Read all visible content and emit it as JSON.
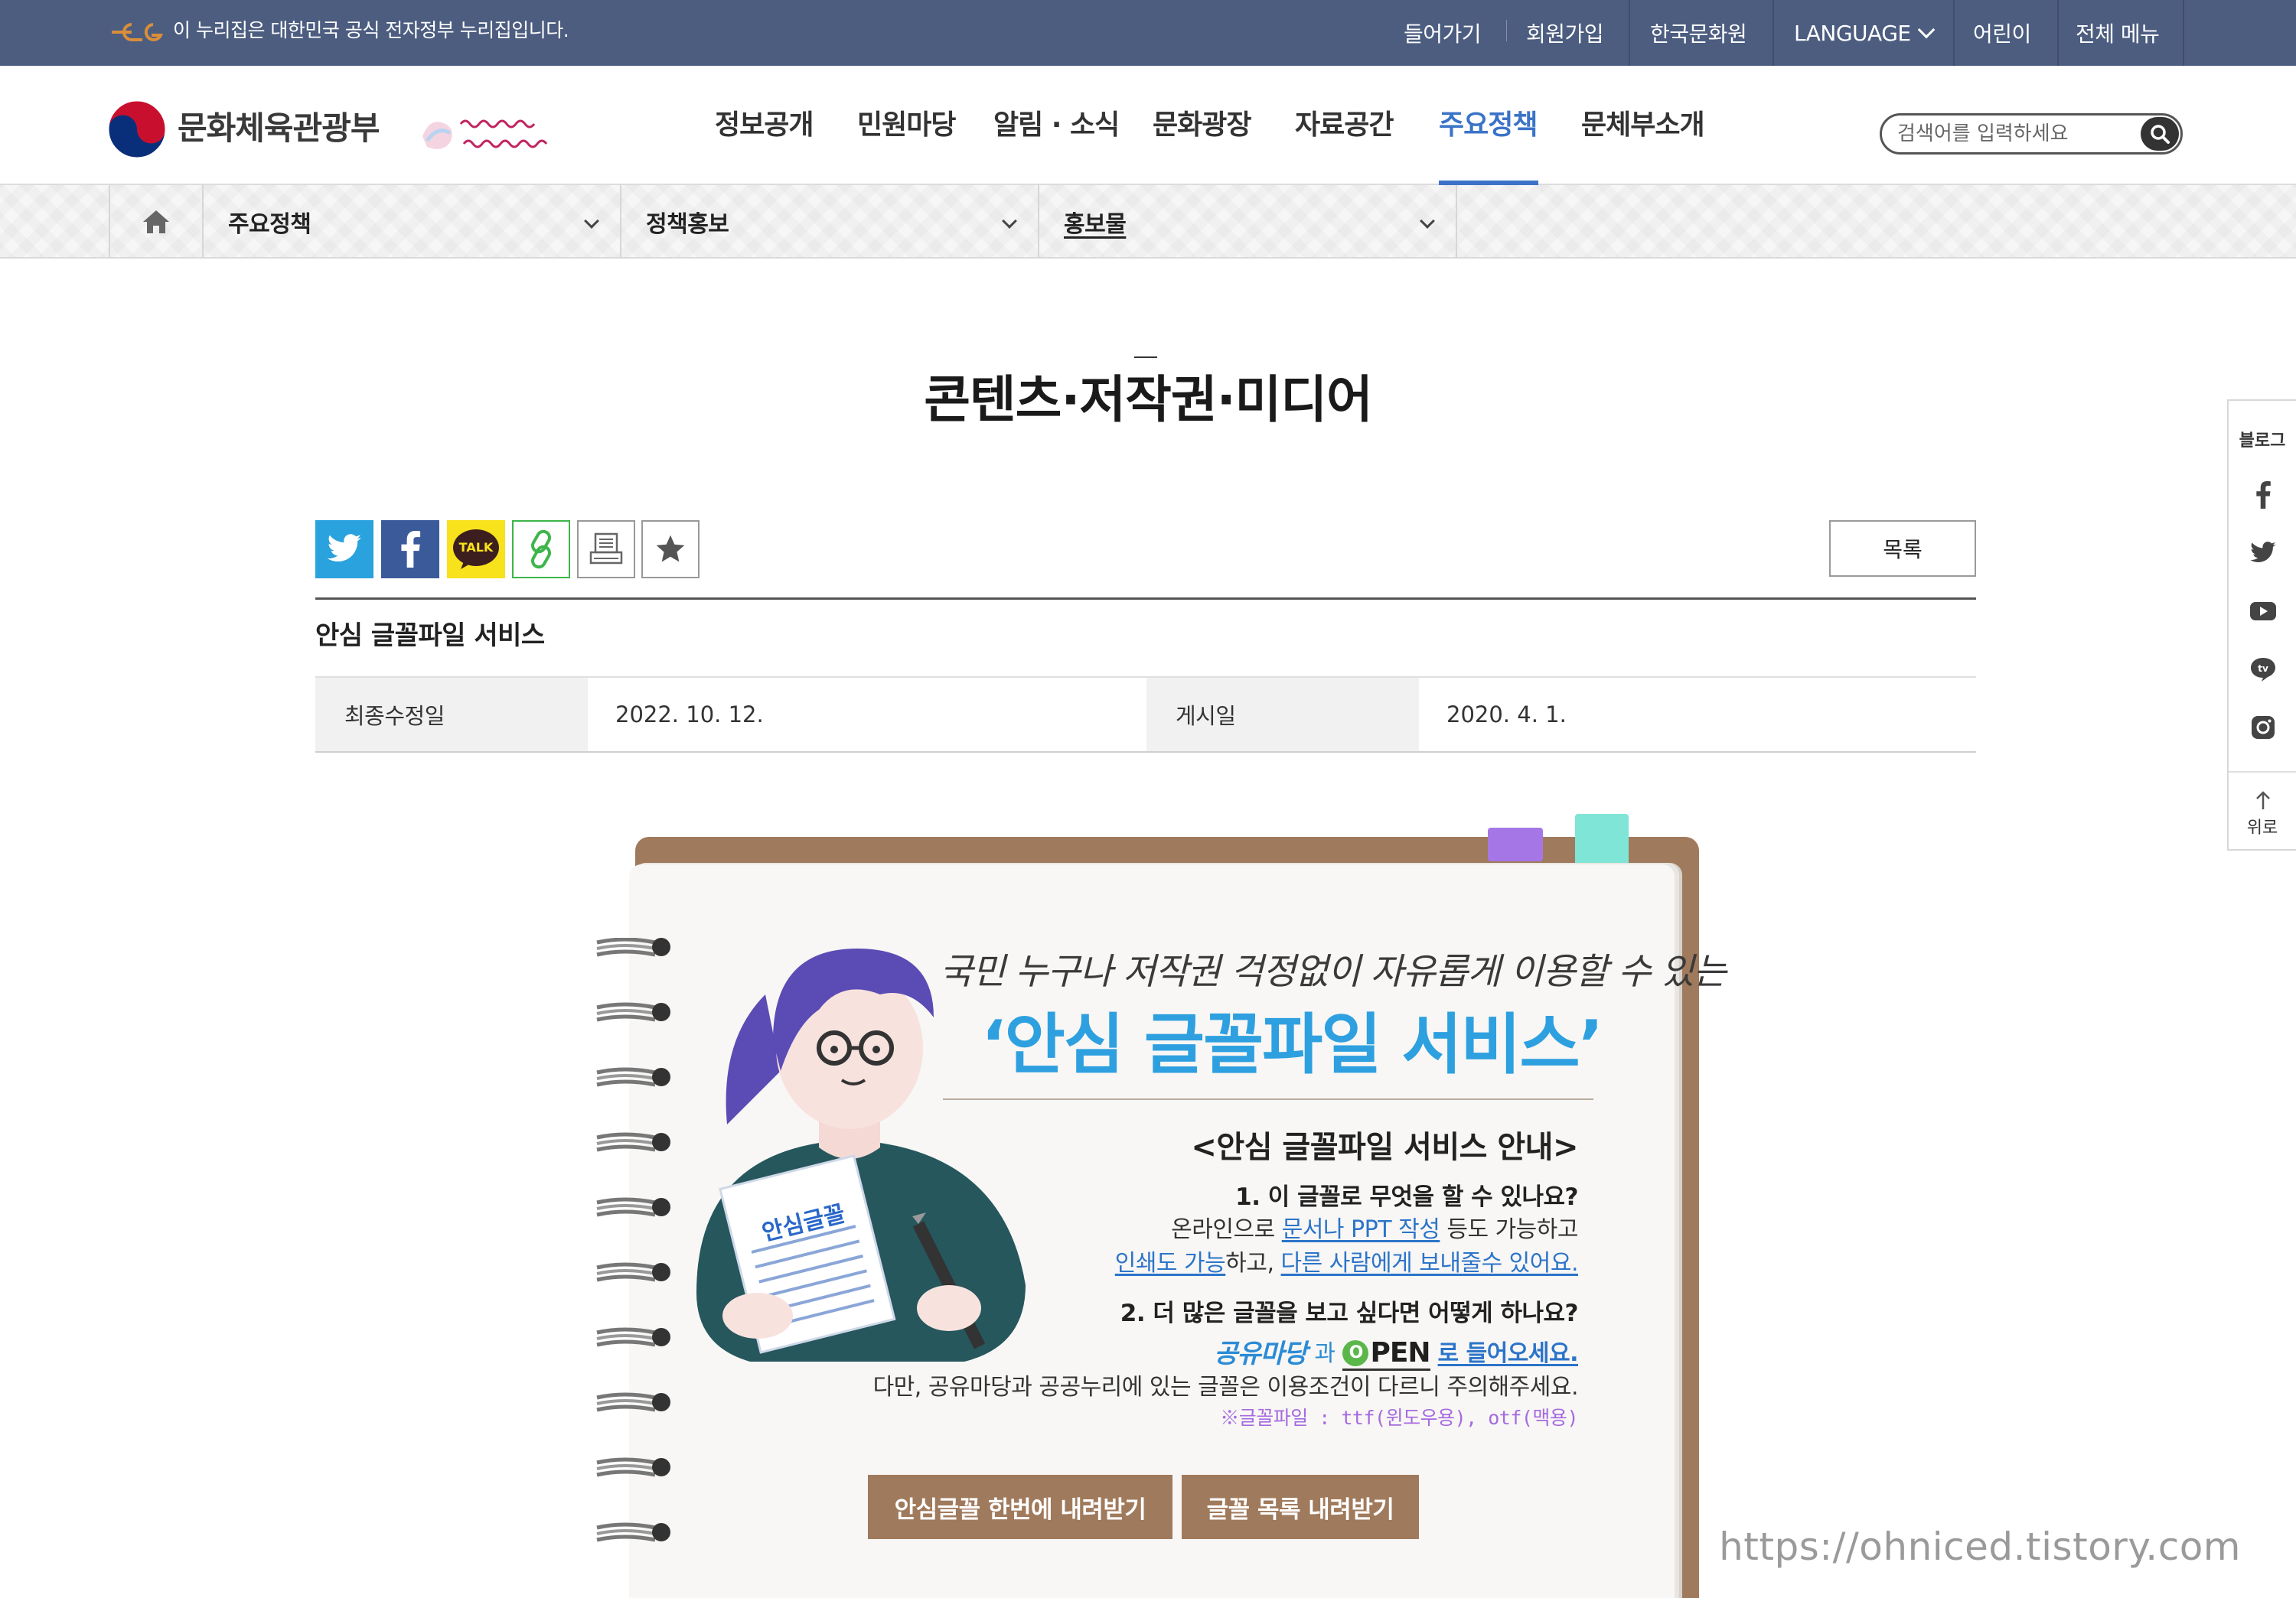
{
  "topbar": {
    "gov_notice": "이 누리집은 대한민국 공식 전자정부 누리집입니다.",
    "login": "들어가기",
    "signup": "회원가입",
    "culture_center": "한국문화원",
    "language": "LANGUAGE",
    "kids": "어린이",
    "all_menu": "전체 메뉴"
  },
  "header": {
    "ministry": "문화체육관광부",
    "nav": [
      "정보공개",
      "민원마당",
      "알림 · 소식",
      "문화광장",
      "자료공간",
      "주요정책",
      "문체부소개"
    ],
    "active_nav": "주요정책",
    "search_placeholder": "검색어를 입력하세요"
  },
  "location": {
    "level1": "주요정책",
    "level2": "정책홍보",
    "level3": "홍보물"
  },
  "page": {
    "title": "콘텐츠·저작권·미디어",
    "list_button": "목록",
    "post_title": "안심 글꼴파일 서비스",
    "modified_label": "최종수정일",
    "modified_value": "2022. 10. 12.",
    "posted_label": "게시일",
    "posted_value": "2020. 4. 1."
  },
  "share": {
    "kakao_label": "TALK"
  },
  "illustration": {
    "handwritten": "국민 누구나 저작권 걱정없이 자유롭게 이용할 수 있는",
    "hero_title": "‘안심 글꼴파일 서비스’",
    "paper_label": "안심글꼴",
    "guide_heading": "<안심 글꼴파일 서비스 안내>",
    "q1": "1. 이 글꼴로 무엇을 할 수 있나요?",
    "a1_pre": "온라인으로 ",
    "a1_link": "문서나 PPT 작성",
    "a1_post": " 등도 가능하고",
    "a2_link1": "인쇄도 가능",
    "a2_mid": "하고, ",
    "a2_link2": "다른 사람에게 보내줄수 있어요.",
    "q2": "2. 더 많은  글꼴을 보고 싶다면 어떻게 하나요?",
    "gongyu": "공유마당",
    "gwa": "과",
    "open": "PEN",
    "open_suffix": "로 들어오세요.",
    "caution": "다만, 공유마당과 공공누리에 있는 글꼴은 이용조건이 다르니 주의해주세요.",
    "filetype": "※글꼴파일 : ttf(윈도우용), otf(맥용)",
    "download_all": "안심글꼴 한번에 내려받기",
    "download_list": "글꼴 목록 내려받기"
  },
  "watermark": "https://ohniced.tistory.com",
  "quickbar": {
    "blog": "블로그",
    "top": "위로"
  },
  "colors": {
    "topbar": "#4c5d80",
    "accent": "#3b73c8",
    "hero_blue": "#2ea0e0",
    "brown": "#a07a5c"
  }
}
